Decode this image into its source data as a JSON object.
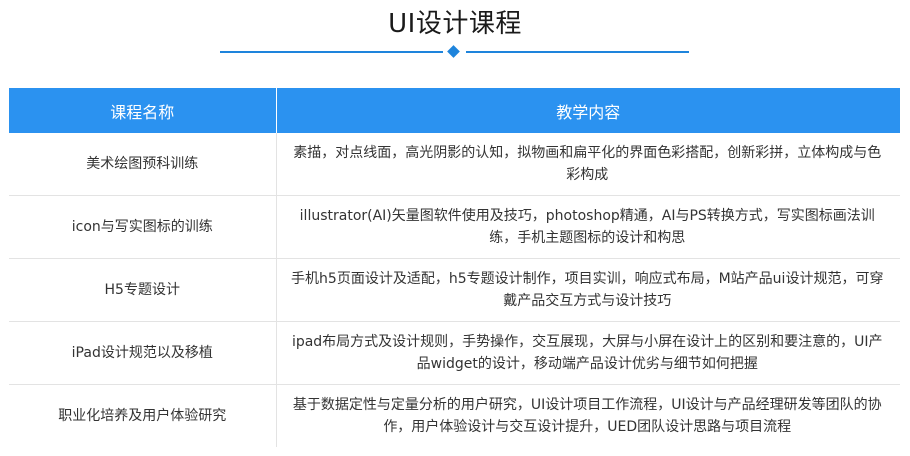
{
  "page": {
    "title": "UI设计课程"
  },
  "table": {
    "headers": [
      "课程名称",
      "教学内容"
    ],
    "rows": [
      {
        "name": "美术绘图预科训练",
        "content": "素描，对点线面，高光阴影的认知，拟物画和扁平化的界面色彩搭配，创新彩拼，立体构成与色彩构成"
      },
      {
        "name": "icon与写实图标的训练",
        "content": "illustrator(AI)矢量图软件使用及技巧，photoshop精通，AI与PS转换方式，写实图标画法训练，手机主题图标的设计和构思"
      },
      {
        "name": "H5专题设计",
        "content": "手机h5页面设计及适配，h5专题设计制作，项目实训，响应式布局，M站产品ui设计规范，可穿戴产品交互方式与设计技巧"
      },
      {
        "name": "iPad设计规范以及移植",
        "content": "ipad布局方式及设计规则，手势操作，交互展现，大屏与小屏在设计上的区别和要注意的，UI产品widget的设计，移动端产品设计优劣与细节如何把握"
      },
      {
        "name": "职业化培养及用户体验研究",
        "content": "基于数据定性与定量分析的用户研究，UI设计项目工作流程，UI设计与产品经理研发等团队的协作，用户体验设计与交互设计提升，UED团队设计思路与项目流程"
      }
    ]
  },
  "colors": {
    "accent": "#2b92f0",
    "divider": "#1e84dc"
  }
}
